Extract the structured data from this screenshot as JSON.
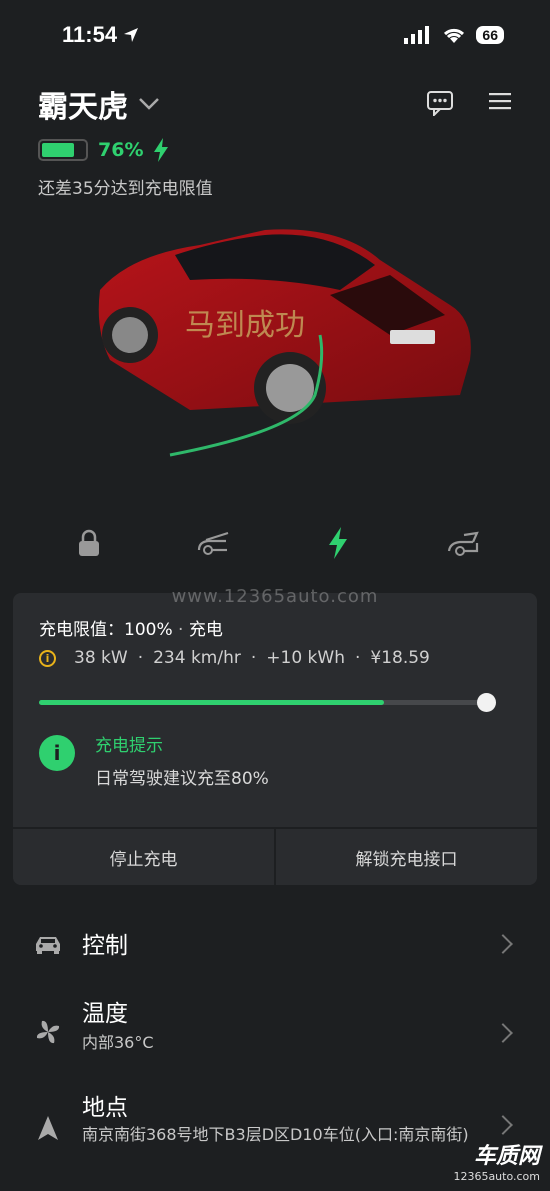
{
  "status_bar": {
    "time": "11:54",
    "battery_level": "66"
  },
  "header": {
    "car_name": "霸天虎",
    "battery_percent": "76%",
    "battery_fraction": 0.76,
    "charge_remaining": "还差35分达到充电限值"
  },
  "quick_actions": [
    "lock-icon",
    "frunk-icon",
    "charge-bolt-icon",
    "trunk-icon"
  ],
  "watermark": "www.12365auto.com",
  "charge_card": {
    "limit_label": "充电限值：100%",
    "sep": "·",
    "status": "充电",
    "power": "38 kW",
    "speed": "234 km/hr",
    "energy": "+10 kWh",
    "cost": "¥18.59",
    "charge_fraction": 0.76,
    "tip_title": "充电提示",
    "tip_body": "日常驾驶建议充至80%",
    "stop_button": "停止充电",
    "unlock_button": "解锁充电接口"
  },
  "menu": {
    "controls": {
      "title": "控制"
    },
    "climate": {
      "title": "温度",
      "subtitle": "内部36°C"
    },
    "location": {
      "title": "地点",
      "subtitle": "南京南街368号地下B3层D区D10车位(入口:南京南街)"
    }
  },
  "corner_logo": {
    "name": "车质网",
    "url": "12365auto.com"
  },
  "colors": {
    "accent": "#2fd06f",
    "warning": "#e8b21a",
    "background": "#1d1f21",
    "card": "#2a2c2f"
  }
}
